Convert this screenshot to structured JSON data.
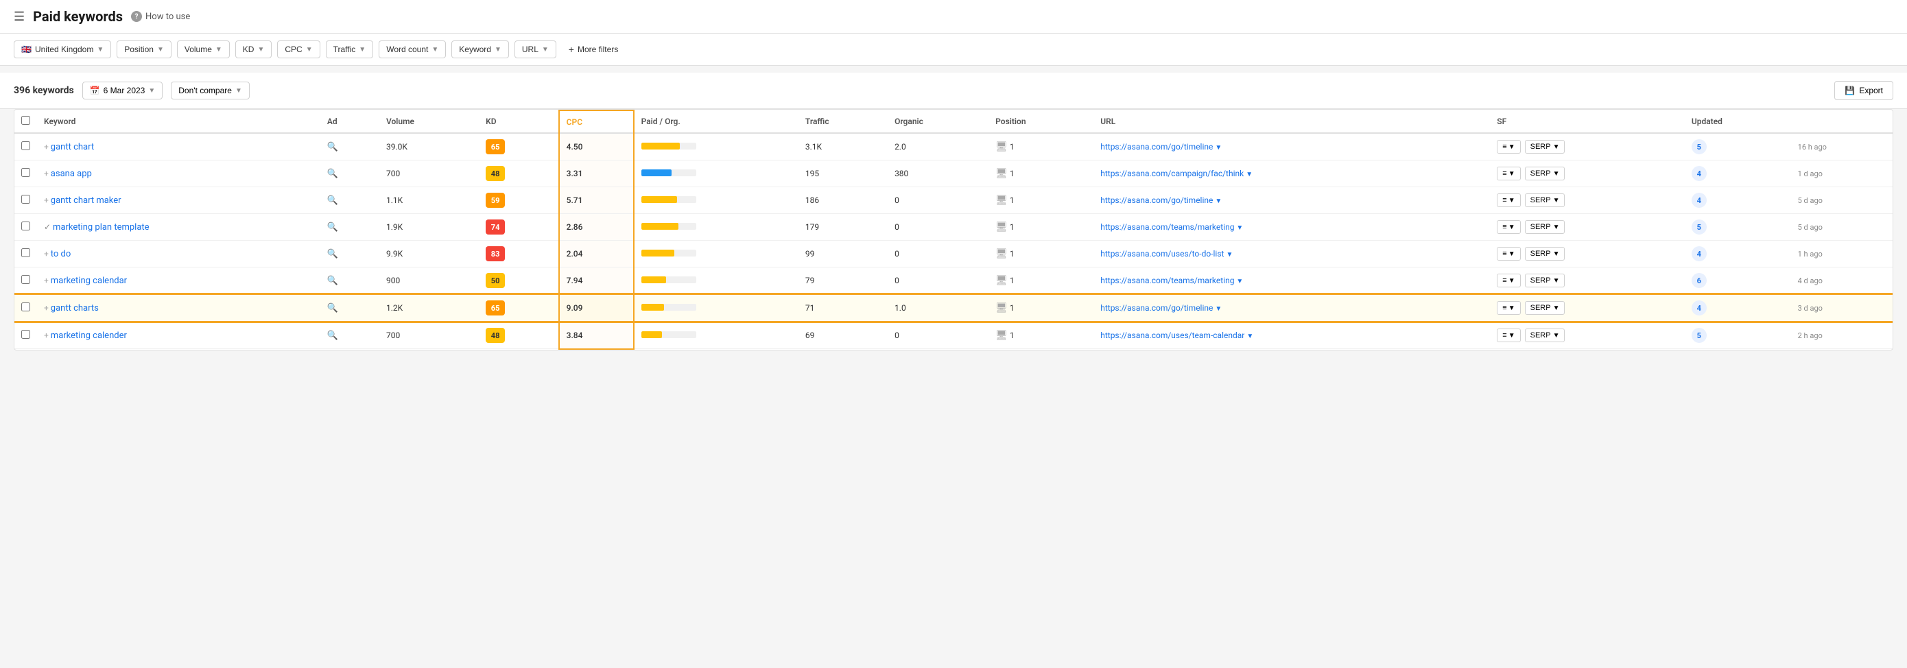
{
  "header": {
    "title": "Paid keywords",
    "howToUse": "How to use"
  },
  "filters": {
    "country": "United Kingdom",
    "countryFlag": "🇬🇧",
    "position": "Position",
    "volume": "Volume",
    "kd": "KD",
    "cpc": "CPC",
    "traffic": "Traffic",
    "wordCount": "Word count",
    "keyword": "Keyword",
    "url": "URL",
    "moreFilters": "More filters"
  },
  "tableControls": {
    "keywordCount": "396 keywords",
    "date": "6 Mar 2023",
    "compare": "Don't compare",
    "export": "Export"
  },
  "tableHeaders": {
    "keyword": "Keyword",
    "ad": "Ad",
    "volume": "Volume",
    "kd": "KD",
    "cpc": "CPC",
    "paidOrg": "Paid / Org.",
    "traffic": "Traffic",
    "organic": "Organic",
    "position": "Position",
    "url": "URL",
    "sf": "SF",
    "updated": "Updated"
  },
  "rows": [
    {
      "keyword": "gantt chart",
      "ad": "+",
      "volume": "39.0K",
      "kd": 65,
      "kdColor": "orange",
      "cpc": "4.50",
      "barWidth": 70,
      "barColor": "yellow",
      "traffic": "3.1K",
      "organic": "2.0",
      "position": "1",
      "url": "https://asana.com/go/timeline",
      "sf": "5",
      "updated": "16 h ago",
      "highlighted": false
    },
    {
      "keyword": "asana app",
      "ad": "+",
      "volume": "700",
      "kd": 48,
      "kdColor": "yellow",
      "cpc": "3.31",
      "barWidth": 55,
      "barColor": "blue",
      "traffic": "195",
      "organic": "380",
      "position": "1",
      "url": "https://asana.com/campaign/fac/think",
      "sf": "4",
      "updated": "1 d ago",
      "highlighted": false
    },
    {
      "keyword": "gantt chart maker",
      "ad": "+",
      "volume": "1.1K",
      "kd": 59,
      "kdColor": "orange",
      "cpc": "5.71",
      "barWidth": 65,
      "barColor": "yellow",
      "traffic": "186",
      "organic": "0",
      "position": "1",
      "url": "https://asana.com/go/timeline",
      "sf": "4",
      "updated": "5 d ago",
      "highlighted": false
    },
    {
      "keyword": "marketing plan template",
      "ad": "✓",
      "volume": "1.9K",
      "kd": 74,
      "kdColor": "red",
      "cpc": "2.86",
      "barWidth": 68,
      "barColor": "yellow",
      "traffic": "179",
      "organic": "0",
      "position": "1",
      "url": "https://asana.com/teams/marketing",
      "sf": "5",
      "updated": "5 d ago",
      "highlighted": false
    },
    {
      "keyword": "to do",
      "ad": "+",
      "volume": "9.9K",
      "kd": 83,
      "kdColor": "red",
      "cpc": "2.04",
      "barWidth": 60,
      "barColor": "yellow",
      "traffic": "99",
      "organic": "0",
      "position": "1",
      "url": "https://asana.com/uses/to-do-list",
      "sf": "4",
      "updated": "1 h ago",
      "highlighted": false
    },
    {
      "keyword": "marketing calendar",
      "ad": "+",
      "volume": "900",
      "kd": 50,
      "kdColor": "yellow",
      "cpc": "7.94",
      "barWidth": 45,
      "barColor": "yellow",
      "traffic": "79",
      "organic": "0",
      "position": "1",
      "url": "https://asana.com/teams/marketing",
      "sf": "6",
      "updated": "4 d ago",
      "highlighted": false
    },
    {
      "keyword": "gantt charts",
      "ad": "+",
      "volume": "1.2K",
      "kd": 65,
      "kdColor": "orange",
      "cpc": "9.09",
      "barWidth": 42,
      "barColor": "yellow",
      "traffic": "71",
      "organic": "1.0",
      "position": "1",
      "url": "https://asana.com/go/timeline",
      "sf": "4",
      "updated": "3 d ago",
      "highlighted": true
    },
    {
      "keyword": "marketing calender",
      "ad": "+",
      "volume": "700",
      "kd": 48,
      "kdColor": "yellow",
      "cpc": "3.84",
      "barWidth": 38,
      "barColor": "yellow",
      "traffic": "69",
      "organic": "0",
      "position": "1",
      "url": "https://asana.com/uses/team-calendar",
      "sf": "5",
      "updated": "2 h ago",
      "highlighted": false
    }
  ]
}
